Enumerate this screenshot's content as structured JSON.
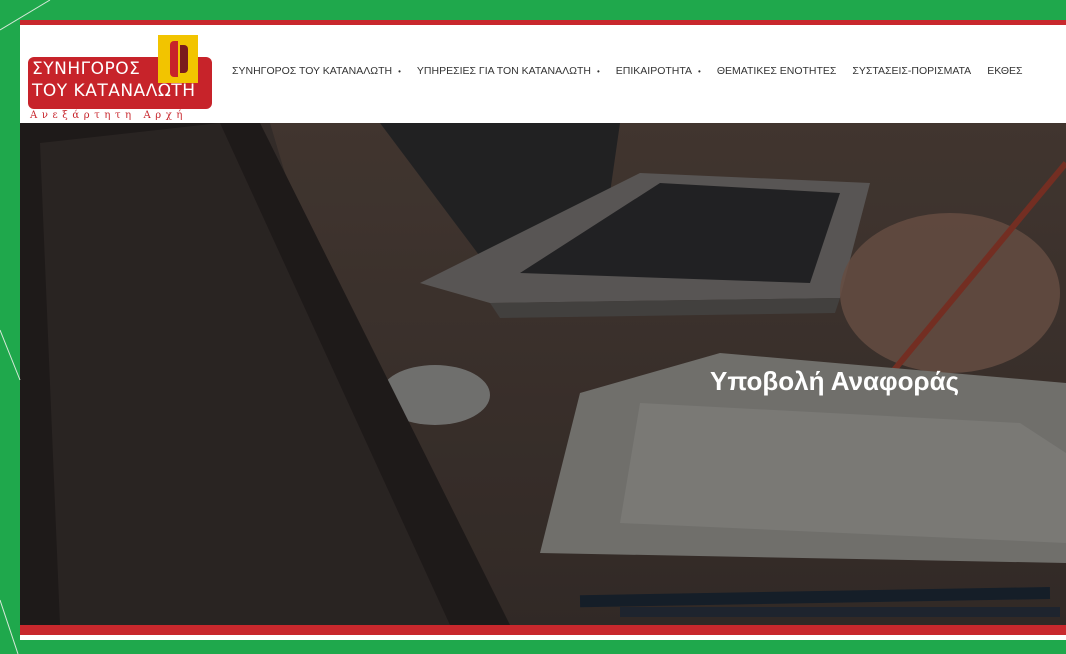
{
  "brand": {
    "logo_line1": "ΣΥΝΗΓΟΡΟΣ",
    "logo_line2": "ΤΟΥ ΚΑΤΑΝΑΛΩΤΗ",
    "logo_subtitle": "Ανεξάρτητη Αρχή",
    "primary_color": "#c7232a",
    "accent_color": "#f2c400",
    "frame_color": "#1fa84c"
  },
  "nav": {
    "items": [
      {
        "label": "ΣΥΝΗΓΟΡΟΣ ΤΟΥ ΚΑΤΑΝΑΛΩΤΗ",
        "has_dropdown": true
      },
      {
        "label": "ΥΠΗΡΕΣΙΕΣ ΓΙΑ ΤΟΝ ΚΑΤΑΝΑΛΩΤΗ",
        "has_dropdown": true
      },
      {
        "label": "ΕΠΙΚΑΙΡΟΤΗΤΑ",
        "has_dropdown": true
      },
      {
        "label": "ΘΕΜΑΤΙΚΕΣ ΕΝΟΤΗΤΕΣ",
        "has_dropdown": false
      },
      {
        "label": "ΣΥΣΤΑΣΕΙΣ-ΠΟΡΙΣΜΑΤΑ",
        "has_dropdown": false
      },
      {
        "label": "ΕΚΘΕΣ",
        "has_dropdown": false
      }
    ],
    "caret": "•"
  },
  "hero": {
    "title": "Υποβολή Αναφοράς"
  }
}
